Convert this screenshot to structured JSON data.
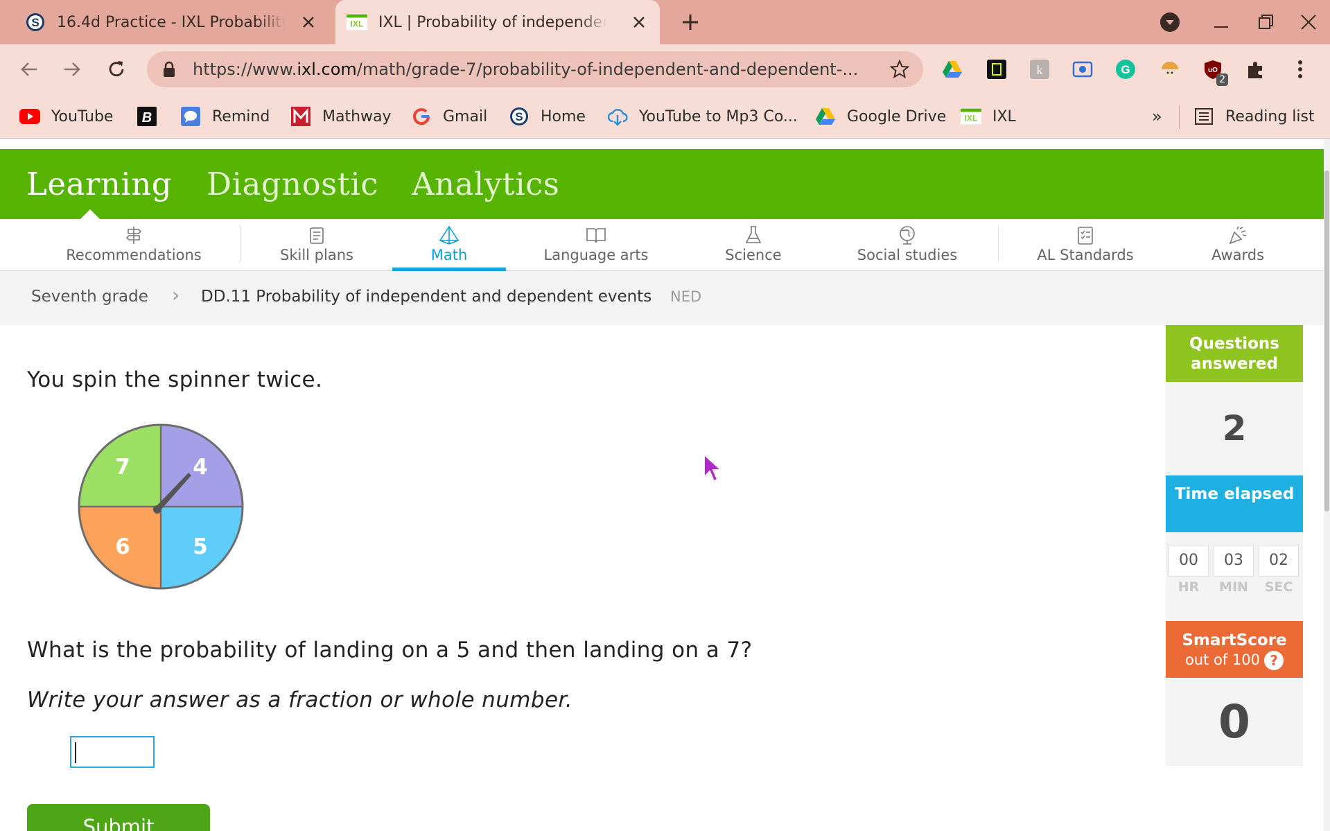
{
  "browser": {
    "tabs": [
      {
        "title": "16.4d Practice - IXL Probability of independent and dependent events",
        "active": false,
        "favicon": "schoology-icon"
      },
      {
        "title": "IXL | Probability of independent and dependent events",
        "active": true,
        "favicon": "ixl-icon"
      }
    ],
    "url_prefix": "https://www.",
    "url_domain": "ixl.com",
    "url_path": "/math/grade-7/probability-of-independent-and-dependent-...",
    "extension_badge": "2",
    "bookmarks": [
      {
        "label": "YouTube",
        "icon": "youtube-icon"
      },
      {
        "label": "",
        "icon": "bold-b-icon"
      },
      {
        "label": "Remind",
        "icon": "remind-icon"
      },
      {
        "label": "Mathway",
        "icon": "mathway-icon"
      },
      {
        "label": "Gmail",
        "icon": "google-icon"
      },
      {
        "label": "Home",
        "icon": "schoology-icon"
      },
      {
        "label": "YouTube to Mp3 Co...",
        "icon": "cloud-download-icon"
      },
      {
        "label": "Google Drive",
        "icon": "google-drive-icon"
      },
      {
        "label": "IXL",
        "icon": "ixl-icon"
      }
    ],
    "more_bookmarks": "»",
    "reading_list": "Reading list"
  },
  "ixl": {
    "main_nav": [
      "Learning",
      "Diagnostic",
      "Analytics"
    ],
    "sub_nav": [
      {
        "label": "Recommendations",
        "icon": "signpost-icon"
      },
      {
        "label": "Skill plans",
        "icon": "clipboard-icon"
      },
      {
        "label": "Math",
        "icon": "pyramid-icon"
      },
      {
        "label": "Language arts",
        "icon": "book-icon"
      },
      {
        "label": "Science",
        "icon": "flask-icon"
      },
      {
        "label": "Social studies",
        "icon": "globe-icon"
      },
      {
        "label": "AL Standards",
        "icon": "checklist-icon"
      },
      {
        "label": "Awards",
        "icon": "party-popper-icon"
      }
    ],
    "breadcrumb": {
      "grade": "Seventh grade",
      "separator": "›",
      "skill": "DD.11 Probability of independent and dependent events",
      "code": "NED"
    }
  },
  "question": {
    "intro": "You spin the spinner twice.",
    "spinner_sections": [
      {
        "label": "7",
        "color": "#9be065"
      },
      {
        "label": "4",
        "color": "#a59fe8"
      },
      {
        "label": "5",
        "color": "#5fcdfa"
      },
      {
        "label": "6",
        "color": "#fba35b"
      }
    ],
    "prompt": "What is the probability of landing on a 5 and then landing on a 7?",
    "instruction": "Write your answer as a fraction or whole number.",
    "answer_value": "",
    "submit_label": "Submit"
  },
  "sidebar": {
    "questions_title": "Questions answered",
    "questions_value": "2",
    "time_title": "Time elapsed",
    "timer": {
      "hr": "00",
      "min": "03",
      "sec": "02"
    },
    "timer_labels": {
      "hr": "HR",
      "min": "MIN",
      "sec": "SEC"
    },
    "smartscore_title": "SmartScore",
    "smartscore_sub": "out of 100",
    "smartscore_help": "?",
    "smartscore_value": "0",
    "colors": {
      "questions": "#8fc31f",
      "time": "#1fb0e3",
      "smartscore": "#ec6a36"
    }
  }
}
